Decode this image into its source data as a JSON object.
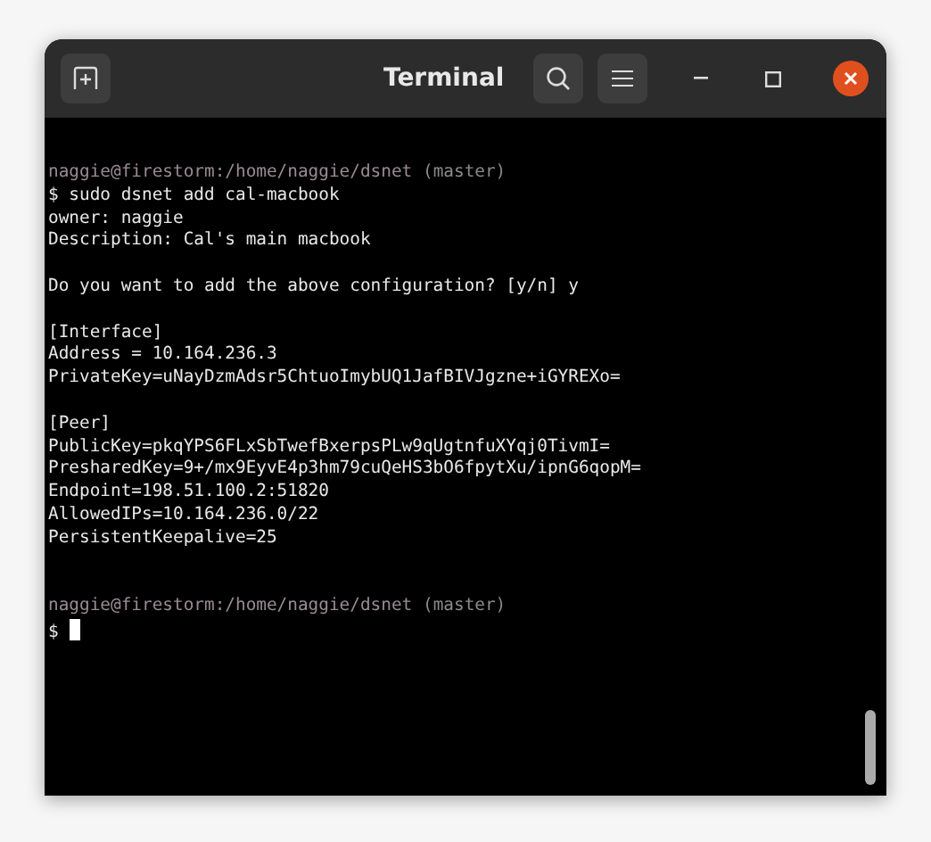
{
  "window": {
    "title": "Terminal"
  },
  "terminal": {
    "lines": [
      {
        "kind": "prompt",
        "path": "naggie@firestorm:/home/naggie/dsnet",
        "branch": "(master)"
      },
      {
        "kind": "output",
        "text": "$ sudo dsnet add cal-macbook"
      },
      {
        "kind": "output",
        "text": "owner: naggie"
      },
      {
        "kind": "output",
        "text": "Description: Cal's main macbook"
      },
      {
        "kind": "blank"
      },
      {
        "kind": "output",
        "text": "Do you want to add the above configuration? [y/n] y"
      },
      {
        "kind": "blank"
      },
      {
        "kind": "output",
        "text": "[Interface]"
      },
      {
        "kind": "output",
        "text": "Address = 10.164.236.3"
      },
      {
        "kind": "output",
        "text": "PrivateKey=uNayDzmAdsr5ChtuoImybUQ1JafBIVJgzne+iGYREXo="
      },
      {
        "kind": "blank"
      },
      {
        "kind": "output",
        "text": "[Peer]"
      },
      {
        "kind": "output",
        "text": "PublicKey=pkqYPS6FLxSbTwefBxerpsPLw9qUgtnfuXYqj0TivmI="
      },
      {
        "kind": "output",
        "text": "PresharedKey=9+/mx9EyvE4p3hm79cuQeHS3bO6fpytXu/ipnG6qopM="
      },
      {
        "kind": "output",
        "text": "Endpoint=198.51.100.2:51820"
      },
      {
        "kind": "output",
        "text": "AllowedIPs=10.164.236.0/22"
      },
      {
        "kind": "output",
        "text": "PersistentKeepalive=25"
      },
      {
        "kind": "blank"
      },
      {
        "kind": "blank"
      },
      {
        "kind": "prompt",
        "path": "naggie@firestorm:/home/naggie/dsnet",
        "branch": "(master)"
      },
      {
        "kind": "input",
        "text": "$"
      }
    ]
  }
}
